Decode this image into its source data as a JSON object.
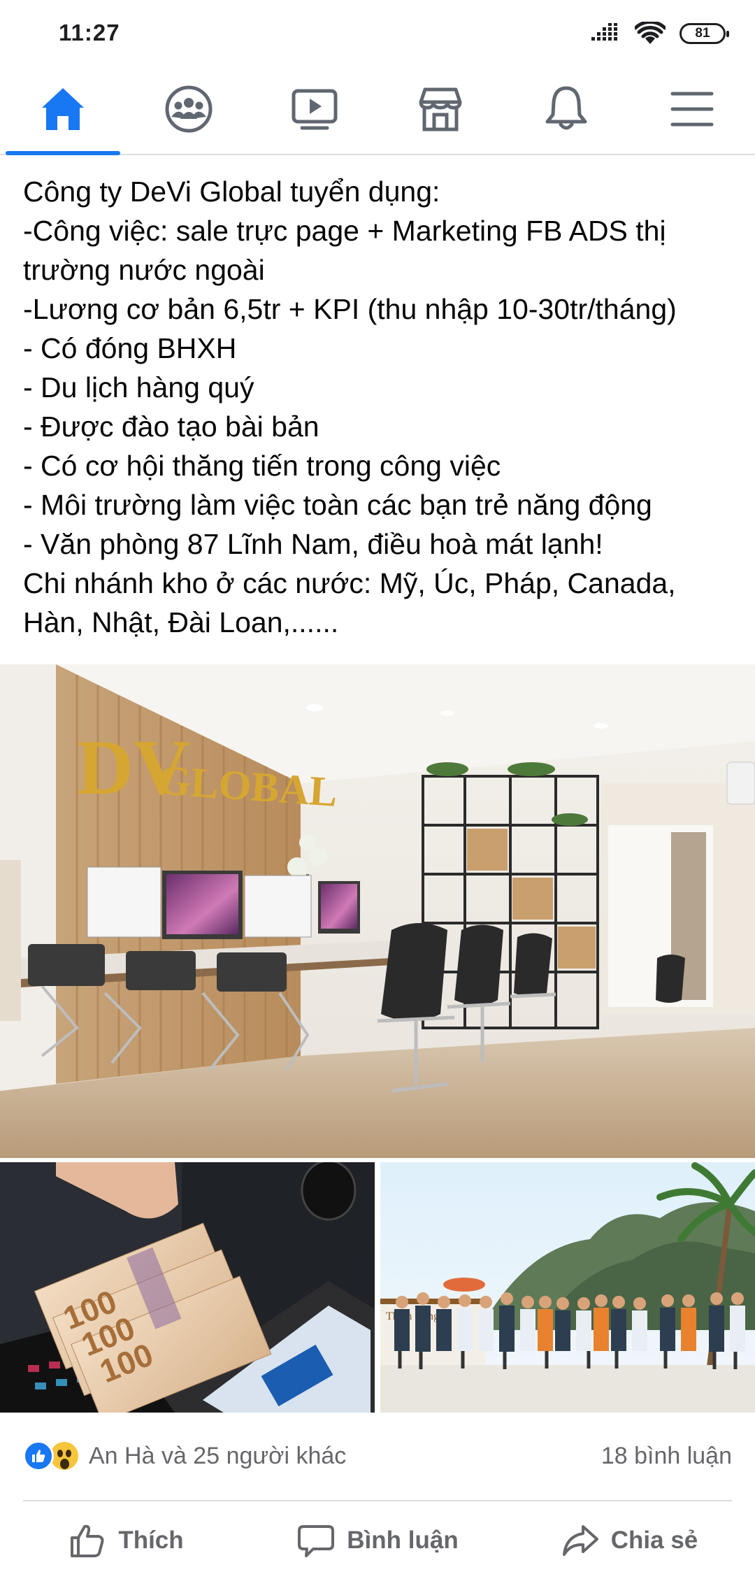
{
  "status": {
    "time": "11:27",
    "battery": "81"
  },
  "nav": {
    "tabs": [
      {
        "name": "home",
        "icon": "home-icon",
        "active": true
      },
      {
        "name": "groups",
        "icon": "groups-icon",
        "active": false
      },
      {
        "name": "watch",
        "icon": "video-icon",
        "active": false
      },
      {
        "name": "marketplace",
        "icon": "store-icon",
        "active": false
      },
      {
        "name": "notifications",
        "icon": "bell-icon",
        "active": false
      },
      {
        "name": "menu",
        "icon": "hamburger-menu-icon",
        "active": false
      }
    ],
    "accent": "#1877f2"
  },
  "post": {
    "lines": [
      "Công ty DeVi Global tuyển dụng:",
      "-Công việc: sale trực page + Marketing FB ADS thị",
      "trường nước ngoài",
      "-Lương cơ bản 6,5tr + KPI (thu nhập 10-30tr/tháng)",
      "- Có đóng BHXH",
      "- Du lịch hàng quý",
      "- Được đào tạo bài bản",
      "- Có cơ hội thăng tiến trong công việc",
      "- Môi trường làm việc toàn các bạn trẻ năng động",
      "- Văn phòng 87 Lĩnh Nam, điều hoà mát lạnh!",
      "Chi nhánh kho ở các nước: Mỹ, Úc, Pháp, Canada,",
      "Hàn, Nhật, Đài Loan,......"
    ],
    "images": {
      "main": {
        "logo_text": "GLOBAL",
        "logo_mark": "DV"
      },
      "left": {
        "banknote": "100"
      },
      "right": {
        "boat_text": "Thiên Cung"
      }
    }
  },
  "reactions": {
    "icons": [
      "like-reaction-icon",
      "wow-reaction-icon"
    ],
    "names": "An Hà và 25 người khác",
    "comments": "18 bình luận"
  },
  "actions": {
    "like": "Thích",
    "comment": "Bình luận",
    "share": "Chia sẻ"
  }
}
